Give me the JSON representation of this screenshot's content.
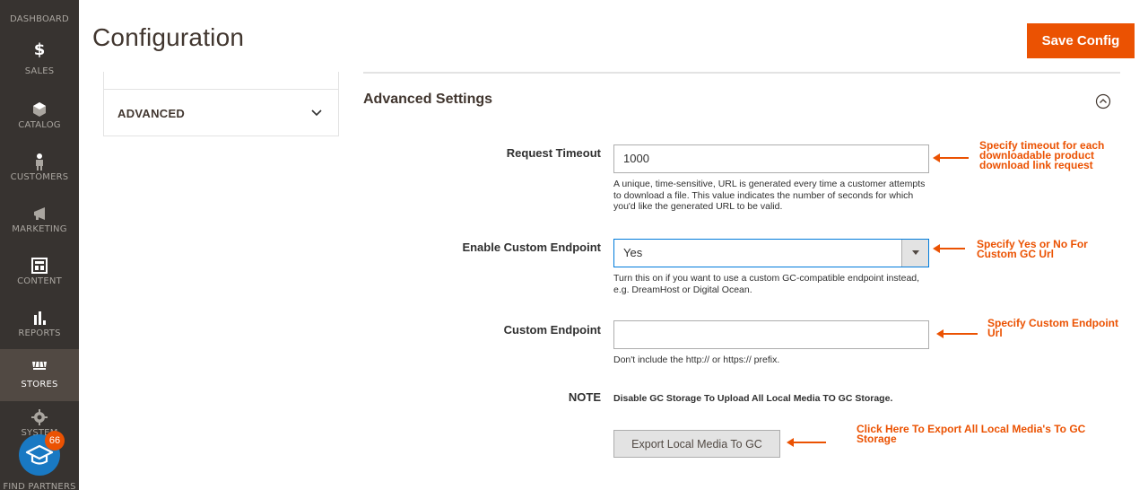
{
  "sidebar": {
    "items": [
      {
        "label": "DASHBOARD",
        "icon": "dashboard-icon"
      },
      {
        "label": "SALES",
        "icon": "dollar-icon"
      },
      {
        "label": "CATALOG",
        "icon": "cube-icon"
      },
      {
        "label": "CUSTOMERS",
        "icon": "person-icon"
      },
      {
        "label": "MARKETING",
        "icon": "megaphone-icon"
      },
      {
        "label": "CONTENT",
        "icon": "layout-icon"
      },
      {
        "label": "REPORTS",
        "icon": "bar-chart-icon"
      },
      {
        "label": "STORES",
        "icon": "store-icon"
      },
      {
        "label": "SYSTEM",
        "icon": "gear-icon"
      },
      {
        "label": "FIND PARTNERS",
        "icon": "partners-icon"
      }
    ],
    "badge_count": "66"
  },
  "header": {
    "title": "Configuration",
    "save_label": "Save Config"
  },
  "left_panel": {
    "section_label": "ADVANCED"
  },
  "main": {
    "section_title": "Advanced Settings",
    "fields": {
      "request_timeout": {
        "label": "Request Timeout",
        "value": "1000",
        "note": "A unique, time-sensitive, URL is generated every time a customer attempts to download a file. This value indicates the number of seconds for which you'd like the generated URL to be valid."
      },
      "enable_custom_endpoint": {
        "label": "Enable Custom Endpoint",
        "value": "Yes",
        "note": "Turn this on if you want to use a custom GC-compatible endpoint instead, e.g. DreamHost or Digital Ocean."
      },
      "custom_endpoint": {
        "label": "Custom Endpoint",
        "value": "",
        "note": "Don't include the http:// or https:// prefix."
      },
      "note": {
        "label": "NOTE",
        "text": "Disable GC Storage To Upload All Local Media TO GC Storage."
      },
      "export": {
        "button_label": "Export Local Media To GC"
      }
    }
  },
  "annotations": {
    "timeout": [
      "Specify timeout for each",
      "downloadable product",
      "download link request"
    ],
    "endpoint_toggle": [
      "Specify Yes or No For",
      "Custom GC Url"
    ],
    "endpoint_url": [
      "Specify Custom Endpoint",
      "Url"
    ],
    "export": [
      "Click Here To Export All Local Media's To GC",
      "Storage"
    ]
  },
  "colors": {
    "accent": "#eb5202",
    "sidebar_bg": "#373330",
    "sidebar_active": "#514943",
    "focus_border": "#007bdb"
  }
}
